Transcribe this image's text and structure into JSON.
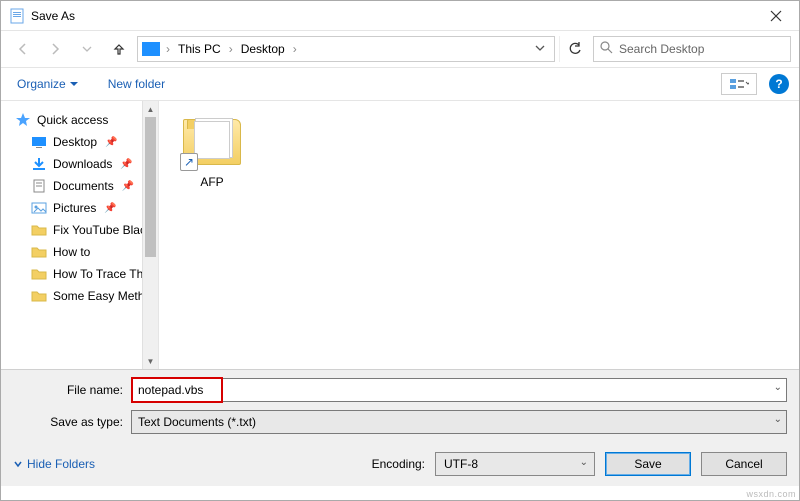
{
  "window": {
    "title": "Save As"
  },
  "nav": {
    "crumbs": [
      "This PC",
      "Desktop"
    ],
    "search_placeholder": "Search Desktop"
  },
  "toolbar": {
    "organize": "Organize",
    "newfolder": "New folder"
  },
  "sidebar": {
    "quick_access": "Quick access",
    "items": [
      {
        "label": "Desktop",
        "pinned": true,
        "icon": "desktop"
      },
      {
        "label": "Downloads",
        "pinned": true,
        "icon": "downloads"
      },
      {
        "label": "Documents",
        "pinned": true,
        "icon": "documents"
      },
      {
        "label": "Pictures",
        "pinned": true,
        "icon": "pictures"
      },
      {
        "label": "Fix YouTube Black",
        "pinned": false,
        "icon": "folder"
      },
      {
        "label": "How to",
        "pinned": false,
        "icon": "folder"
      },
      {
        "label": "How To Trace The",
        "pinned": false,
        "icon": "folder"
      },
      {
        "label": "Some Easy Methods",
        "pinned": false,
        "icon": "folder"
      }
    ]
  },
  "content": {
    "items": [
      {
        "name": "AFP"
      }
    ]
  },
  "form": {
    "filename_label": "File name:",
    "filename_value": "notepad.vbs",
    "saveastype_label": "Save as type:",
    "saveastype_value": "Text Documents (*.txt)"
  },
  "footer": {
    "hide_folders": "Hide Folders",
    "encoding_label": "Encoding:",
    "encoding_value": "UTF-8",
    "save": "Save",
    "cancel": "Cancel"
  },
  "watermark": "wsxdn.com"
}
